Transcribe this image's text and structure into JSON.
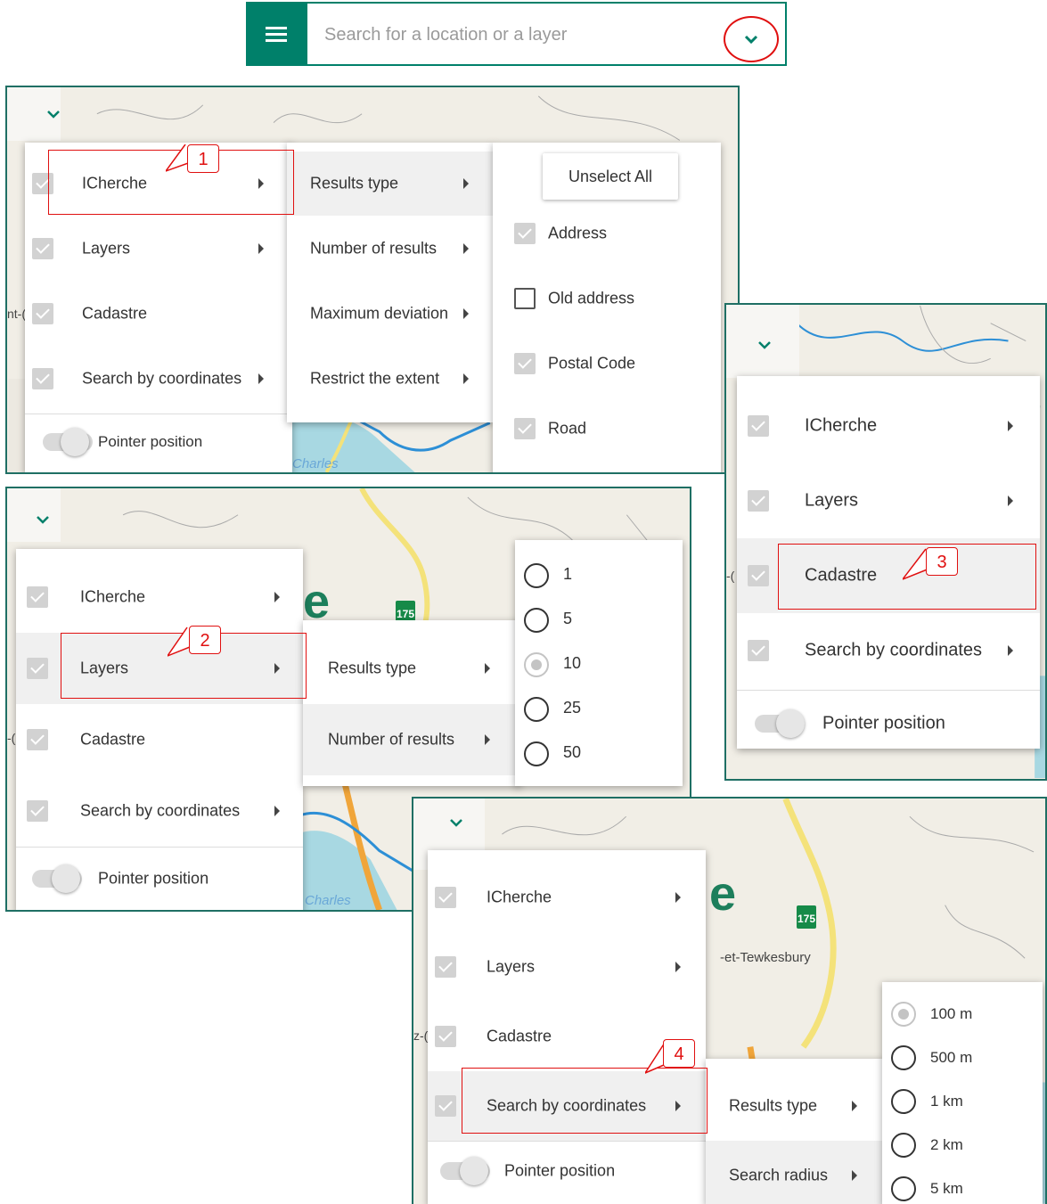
{
  "search": {
    "placeholder": "Search for a location or a layer"
  },
  "icons": {
    "menu": "hamburger-menu-icon",
    "chevron": "chevron-down-icon",
    "submenu": "arrow-right-icon"
  },
  "colors": {
    "accent": "#00806a",
    "annotation": "#e01010",
    "frame": "#1f6f64"
  },
  "panels": {
    "p1": {
      "menu": [
        "ICherche",
        "Layers",
        "Cadastre",
        "Search by coordinates"
      ],
      "pointer": "Pointer position",
      "submenu": [
        "Results type",
        "Number of results",
        "Maximum deviation",
        "Restrict the extent"
      ],
      "options": {
        "unselect": "Unselect All",
        "items": [
          {
            "label": "Address",
            "checked": true
          },
          {
            "label": "Old address",
            "checked": false
          },
          {
            "label": "Postal Code",
            "checked": true
          },
          {
            "label": "Road",
            "checked": true
          }
        ]
      },
      "map_label": "Charles",
      "callout": "1"
    },
    "p2": {
      "menu": [
        "ICherche",
        "Layers",
        "Cadastre",
        "Search by coordinates"
      ],
      "pointer": "Pointer position",
      "submenu": [
        "Results type",
        "Number of results"
      ],
      "options": [
        "1",
        "5",
        "10",
        "25",
        "50"
      ],
      "selected": "10",
      "map_label": "Charles",
      "road": "175",
      "callout": "2"
    },
    "p3": {
      "menu": [
        "ICherche",
        "Layers",
        "Cadastre",
        "Search by coordinates"
      ],
      "pointer": "Pointer position",
      "callout": "3"
    },
    "p4": {
      "menu": [
        "ICherche",
        "Layers",
        "Cadastre",
        "Search by coordinates"
      ],
      "pointer": "Pointer position",
      "submenu": [
        "Results type",
        "Search radius"
      ],
      "options": [
        "100 m",
        "500 m",
        "1 km",
        "2 km",
        "5 km"
      ],
      "selected": "100 m",
      "map_label": "-et-Tewkesbury",
      "road": "175",
      "callout": "4"
    }
  }
}
